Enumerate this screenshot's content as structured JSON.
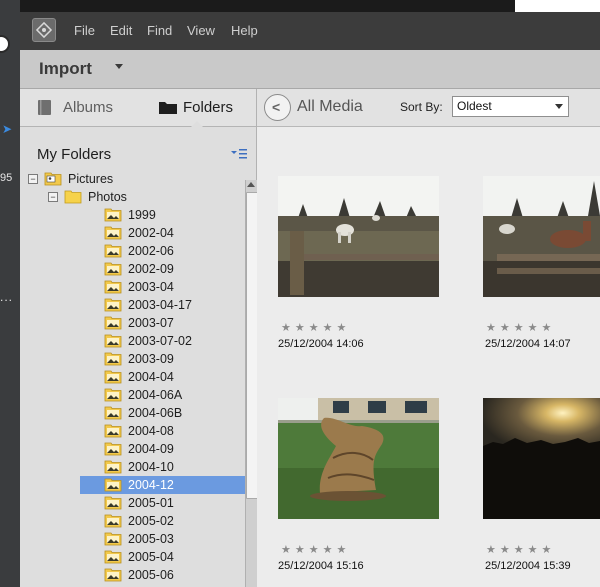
{
  "desktop": {
    "left_text": "95"
  },
  "menu": [
    "File",
    "Edit",
    "Find",
    "View",
    "Help"
  ],
  "toolbar": {
    "import_label": "Import"
  },
  "tabs": {
    "albums": "Albums",
    "folders": "Folders"
  },
  "panel": {
    "title": "My Folders"
  },
  "tree": [
    {
      "label": "Pictures",
      "level": 0,
      "type": "pictures",
      "expanded": true
    },
    {
      "label": "Photos",
      "level": 1,
      "type": "folder",
      "expanded": true
    },
    {
      "label": "1999",
      "level": 2,
      "type": "photo"
    },
    {
      "label": "2002-04",
      "level": 2,
      "type": "photo"
    },
    {
      "label": "2002-06",
      "level": 2,
      "type": "photo"
    },
    {
      "label": "2002-09",
      "level": 2,
      "type": "photo"
    },
    {
      "label": "2003-04",
      "level": 2,
      "type": "photo"
    },
    {
      "label": "2003-04-17",
      "level": 2,
      "type": "photo"
    },
    {
      "label": "2003-07",
      "level": 2,
      "type": "photo"
    },
    {
      "label": "2003-07-02",
      "level": 2,
      "type": "photo"
    },
    {
      "label": "2003-09",
      "level": 2,
      "type": "photo"
    },
    {
      "label": "2004-04",
      "level": 2,
      "type": "photo"
    },
    {
      "label": "2004-06A",
      "level": 2,
      "type": "photo"
    },
    {
      "label": "2004-06B",
      "level": 2,
      "type": "photo"
    },
    {
      "label": "2004-08",
      "level": 2,
      "type": "photo"
    },
    {
      "label": "2004-09",
      "level": 2,
      "type": "photo"
    },
    {
      "label": "2004-10",
      "level": 2,
      "type": "photo"
    },
    {
      "label": "2004-12",
      "level": 2,
      "type": "photo",
      "selected": true
    },
    {
      "label": "2005-01",
      "level": 2,
      "type": "photo"
    },
    {
      "label": "2005-02",
      "level": 2,
      "type": "photo"
    },
    {
      "label": "2005-03",
      "level": 2,
      "type": "photo"
    },
    {
      "label": "2005-04",
      "level": 2,
      "type": "photo"
    },
    {
      "label": "2005-06",
      "level": 2,
      "type": "photo"
    }
  ],
  "main": {
    "title": "All Media",
    "sort_label": "Sort By:",
    "sort_value": "Oldest",
    "media": [
      {
        "date": "25/12/2004 14:06",
        "scene": "horses-field",
        "rating": 0
      },
      {
        "date": "25/12/2004 14:07",
        "scene": "horses-fence",
        "rating": 0
      },
      {
        "date": "25/12/2004 15:16",
        "scene": "tree-sculpture",
        "rating": 0
      },
      {
        "date": "25/12/2004 15:39",
        "scene": "sunset",
        "rating": 0
      }
    ]
  },
  "colors": {
    "selected_row": "#6b9ae0",
    "menubar": "#3c3c3c",
    "panel": "#dedede"
  }
}
